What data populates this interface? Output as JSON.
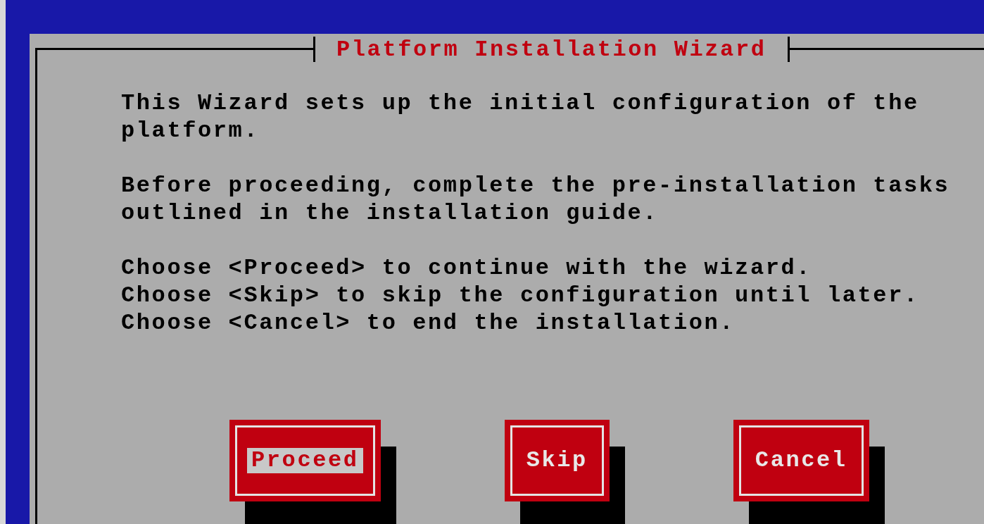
{
  "dialog": {
    "title": "Platform Installation Wizard",
    "paragraphs": [
      [
        "This Wizard sets up the initial configuration of the",
        "platform."
      ],
      [
        "Before proceeding, complete the pre-installation tasks",
        "outlined in the installation guide."
      ],
      [
        "Choose <Proceed> to continue with the wizard.",
        "Choose <Skip> to skip the configuration until later.",
        "Choose <Cancel> to end the installation."
      ]
    ],
    "buttons": [
      {
        "label": "Proceed",
        "selected": true
      },
      {
        "label": "Skip",
        "selected": false
      },
      {
        "label": "Cancel",
        "selected": false
      }
    ]
  }
}
